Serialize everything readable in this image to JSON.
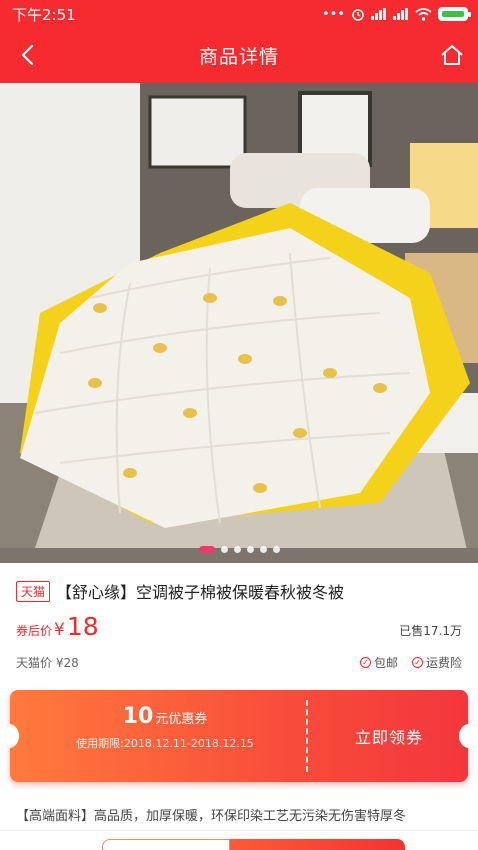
{
  "status_bar": {
    "time": "下午2:51",
    "icons": [
      "dots-icon",
      "alarm-icon",
      "signal-icon",
      "signal-icon",
      "wifi-icon",
      "battery-charging-icon"
    ]
  },
  "nav": {
    "title": "商品详情",
    "back_icon": "chevron-left-icon",
    "home_icon": "home-icon"
  },
  "gallery": {
    "dot_count": 6,
    "active_index": 0
  },
  "product": {
    "platform_tag": "天猫",
    "title": "【舒心缘】空调被子棉被保暖春秋被冬被",
    "price_label": "券后价",
    "currency": "¥",
    "price": "18",
    "sold": "已售17.1万",
    "original_price": "天猫价 ¥28",
    "badges": [
      "包邮",
      "运费险"
    ]
  },
  "coupon": {
    "amount": "10",
    "amount_suffix": "元优惠券",
    "period": "使用期限:2018.12.11-2018.12.15",
    "button": "立即领券"
  },
  "description": "【高端面料】高品质，加厚保暖，环保印染工艺无污染无伤害特厚冬",
  "colors": {
    "brand_red": "#f52b2f",
    "coupon_orange": "#ff7a3c",
    "active_dot": "#f03a6c",
    "duvet_yellow": "#f5d21a"
  }
}
